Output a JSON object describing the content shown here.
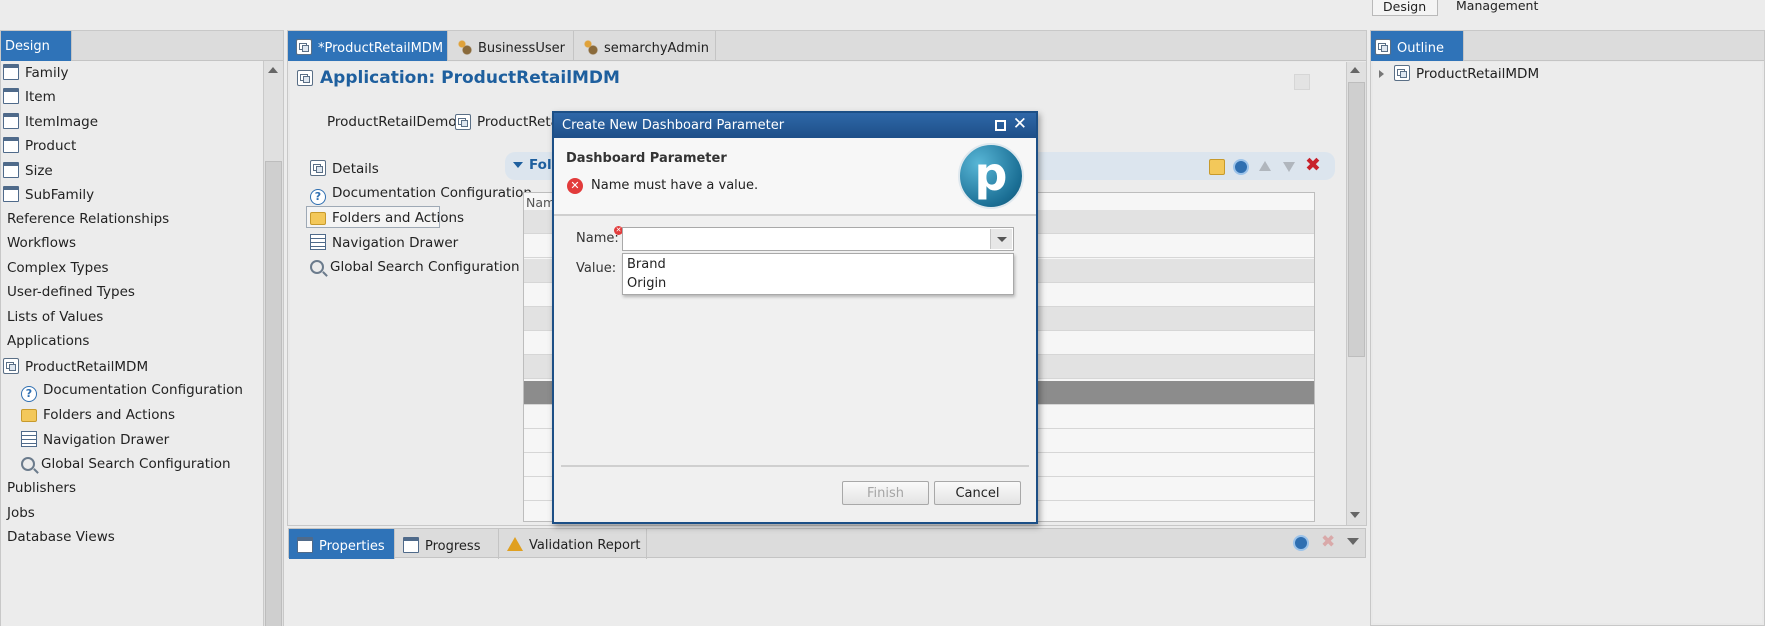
{
  "perspective": {
    "design_label": "Design",
    "management_label": "Management"
  },
  "left_panel": {
    "tab_label": "Design",
    "tree": [
      {
        "label": "Family",
        "icon": "entity-icon"
      },
      {
        "label": "Item",
        "icon": "entity-icon"
      },
      {
        "label": "ItemImage",
        "icon": "entity-icon"
      },
      {
        "label": "Product",
        "icon": "entity-icon"
      },
      {
        "label": "Size",
        "icon": "entity-icon"
      },
      {
        "label": "SubFamily",
        "icon": "entity-icon"
      },
      {
        "label": "Reference Relationships"
      },
      {
        "label": "Workflows"
      },
      {
        "label": "Complex Types"
      },
      {
        "label": "User-defined Types"
      },
      {
        "label": "Lists of Values"
      },
      {
        "label": "Applications"
      },
      {
        "label": "ProductRetailMDM",
        "icon": "application-icon"
      },
      {
        "label": "Documentation Configuration",
        "icon": "help-icon"
      },
      {
        "label": "Folders and Actions",
        "icon": "folder-icon"
      },
      {
        "label": "Navigation Drawer",
        "icon": "navigation-icon"
      },
      {
        "label": "Global Search Configuration",
        "icon": "search-icon"
      },
      {
        "label": "Publishers"
      },
      {
        "label": "Jobs"
      },
      {
        "label": "Database Views"
      }
    ]
  },
  "editor": {
    "tabs": [
      {
        "label": "*ProductRetailMDM"
      },
      {
        "label": "BusinessUser"
      },
      {
        "label": "semarchyAdmin"
      }
    ],
    "title": "Application: ProductRetailMDM",
    "model_link": "ProductRetailDemo",
    "app_link": "ProductRetailM",
    "sections": [
      {
        "label": "Details"
      },
      {
        "label": "Documentation Configuration"
      },
      {
        "label": "Folders and Actions"
      },
      {
        "label": "Navigation Drawer"
      },
      {
        "label": "Global Search Configuration"
      }
    ],
    "section_bar_label": "Fold",
    "grid_header": "Nam"
  },
  "outline": {
    "tab_label": "Outline",
    "root": "ProductRetailMDM"
  },
  "bottom_panel": {
    "tabs": [
      {
        "label": "Properties"
      },
      {
        "label": "Progress"
      },
      {
        "label": "Validation Report"
      }
    ]
  },
  "dialog": {
    "title": "Create New Dashboard Parameter",
    "heading": "Dashboard Parameter",
    "error_message": "Name must have a value.",
    "logo_letter": "p",
    "name_label": "Name:",
    "name_value": "",
    "value_label": "Value:",
    "name_options": [
      "Brand",
      "Origin"
    ],
    "finish_label": "Finish",
    "cancel_label": "Cancel"
  },
  "colors": {
    "accent": "#2f73b8",
    "title_blue": "#1e5f9e",
    "error_red": "#e23b3b",
    "delete_red": "#c8202a"
  }
}
